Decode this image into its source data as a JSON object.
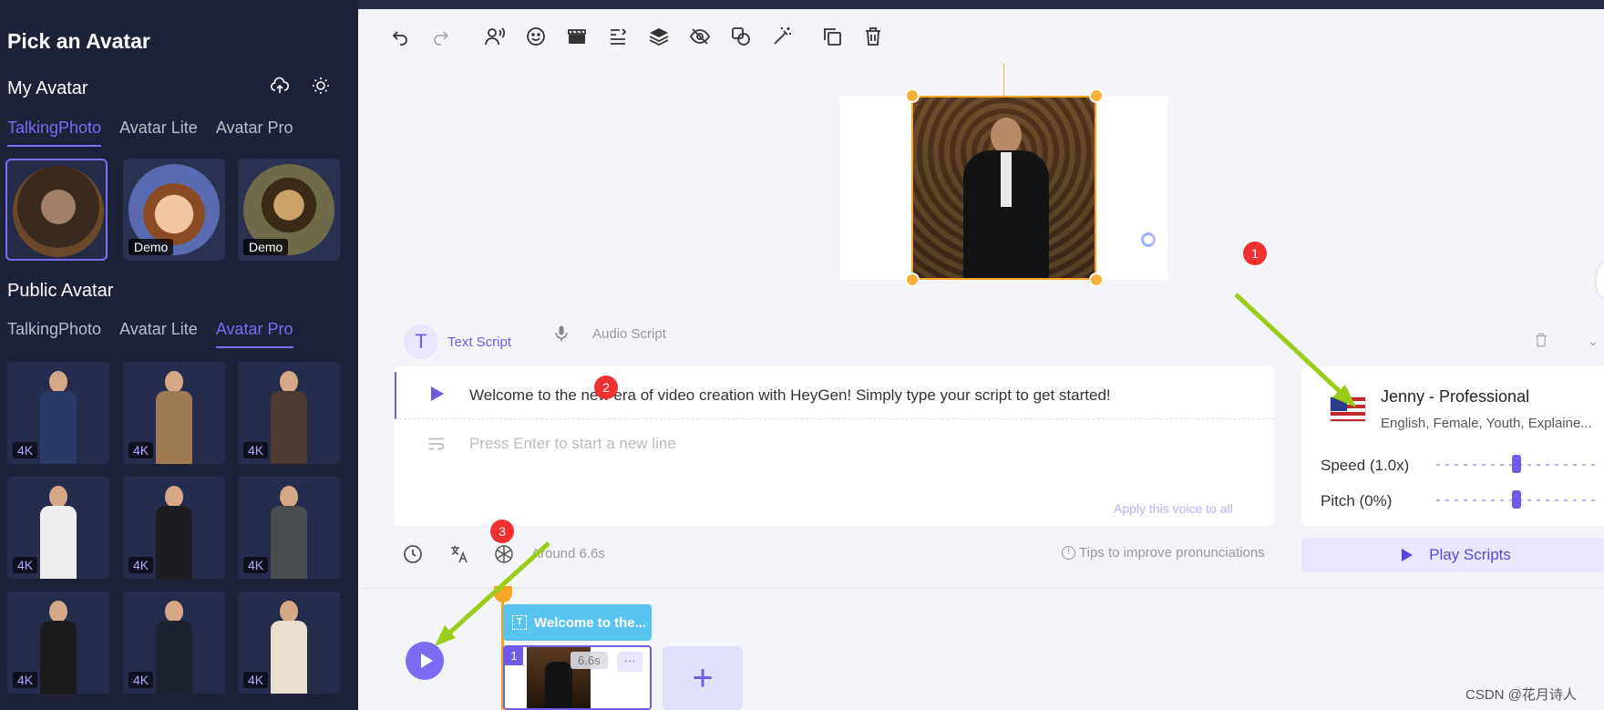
{
  "sidebar": {
    "title": "Pick an Avatar",
    "my_avatar": {
      "heading": "My Avatar",
      "tabs": [
        "TalkingPhoto",
        "Avatar Lite",
        "Avatar Pro"
      ],
      "active_tab": "TalkingPhoto",
      "cards": [
        {
          "name": "custom-asian-man",
          "badge": ""
        },
        {
          "name": "cartoon-man",
          "badge": "Demo"
        },
        {
          "name": "mona-lisa",
          "badge": "Demo"
        }
      ]
    },
    "public_avatar": {
      "heading": "Public Avatar",
      "tabs": [
        "TalkingPhoto",
        "Avatar Lite",
        "Avatar Pro"
      ],
      "active_tab": "Avatar Pro",
      "badge": "4K",
      "cards": [
        {
          "outfit": "vest",
          "color": "#2a3a66"
        },
        {
          "outfit": "trenchcoat",
          "color": "#a07a52"
        },
        {
          "outfit": "brown-sweater",
          "color": "#4c3a33"
        },
        {
          "outfit": "white-tshirt",
          "color": "#eeeeee"
        },
        {
          "outfit": "black-suit",
          "color": "#1e1e22"
        },
        {
          "outfit": "grey-shirt",
          "color": "#4a4d50"
        },
        {
          "outfit": "black-blazer",
          "color": "#1c1c1e"
        },
        {
          "outfit": "navy-suit",
          "color": "#1c2230"
        },
        {
          "outfit": "cream-shirt",
          "color": "#e8dfcf"
        }
      ]
    }
  },
  "toolbar": {
    "icons": [
      "undo-icon",
      "redo-icon",
      "avatar-voice-icon",
      "emoji-icon",
      "clapperboard-icon",
      "align-icon",
      "layers-icon",
      "hide-icon",
      "shapes-icon",
      "magic-wand-icon",
      "duplicate-icon",
      "trash-icon"
    ]
  },
  "markers": {
    "m1": "1",
    "m2": "2",
    "m3": "3"
  },
  "script": {
    "tab_text": "Text Script",
    "tab_audio": "Audio Script",
    "line1": "Welcome to the new era of video creation with HeyGen! Simply type your script to get started!",
    "placeholder": "Press Enter to start a new line",
    "apply_voice": "Apply this voice to all",
    "duration": "Around 6.6s",
    "tips": "Tips to improve pronunciations"
  },
  "voice": {
    "name": "Jenny - Professional",
    "details": "English, Female, Youth, Explaine...",
    "speed_label": "Speed (1.0x)",
    "speed_value": 0.5,
    "pitch_label": "Pitch (0%)",
    "pitch_value": 0.5,
    "play_label": "Play Scripts"
  },
  "timeline": {
    "caption": "Welcome to the...",
    "scene_number": "1",
    "duration": "6.6s",
    "more": "···",
    "add": "+"
  },
  "watermark": "CSDN @花月诗人",
  "colors": {
    "accent": "#7c6cf3",
    "sidebar": "#1d2239",
    "handle": "#f6b13a",
    "marker": "#f03131",
    "arrow": "#9ccc1a"
  }
}
